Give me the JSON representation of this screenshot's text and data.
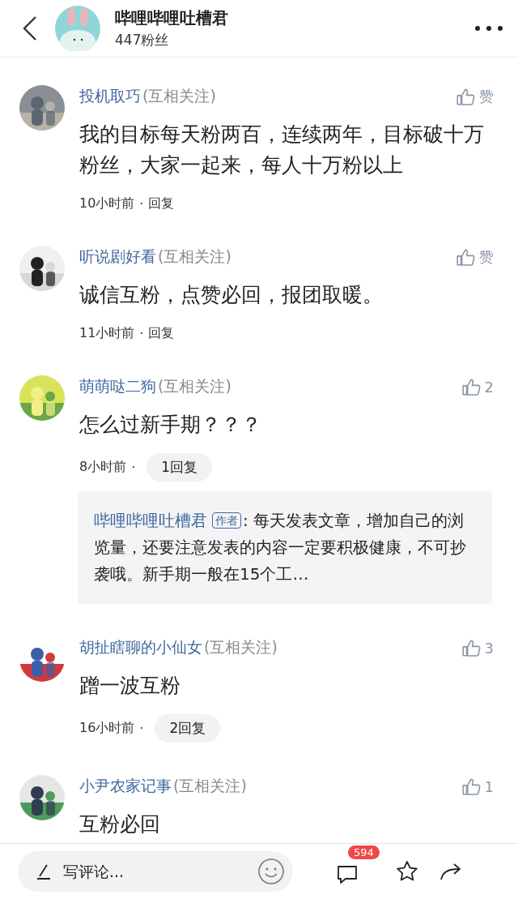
{
  "header": {
    "title": "哔哩哔哩吐槽君",
    "subtitle": "447粉丝"
  },
  "comments": [
    {
      "name": "投机取巧",
      "tag": "(互相关注)",
      "like": "赞",
      "text": "我的目标每天粉两百，连续两年，目标破十万粉丝，大家一起来，每人十万粉以上",
      "time": "10小时前",
      "separator": "·",
      "reply": {
        "kind": "link",
        "label": "回复"
      }
    },
    {
      "name": "听说剧好看",
      "tag": "(互相关注)",
      "like": "赞",
      "text": "诚信互粉，点赞必回，报团取暖。",
      "time": "11小时前",
      "separator": "·",
      "reply": {
        "kind": "link",
        "label": "回复"
      }
    },
    {
      "name": "萌萌哒二狗",
      "tag": "(互相关注)",
      "like": "2",
      "text": "怎么过新手期？？？",
      "time": "8小时前",
      "separator": "·",
      "reply": {
        "kind": "pill",
        "label": "1回复"
      },
      "preview": {
        "author": "哔哩哔哩吐槽君",
        "badge": "作者",
        "text": ": 每天发表文章，增加自己的浏览量，还要注意发表的内容一定要积极健康，不可抄袭哦。新手期一般在15个工…"
      }
    },
    {
      "name": "胡扯瞎聊的小仙女",
      "tag": "(互相关注)",
      "like": "3",
      "text": "蹭一波互粉",
      "time": "16小时前",
      "separator": "·",
      "reply": {
        "kind": "pill",
        "label": "2回复"
      }
    },
    {
      "name": "小尹农家记事",
      "tag": "(互相关注)",
      "like": "1",
      "text": "互粉必回"
    }
  ],
  "bottom_bar": {
    "placeholder": "写评论...",
    "comment_count": "594"
  }
}
